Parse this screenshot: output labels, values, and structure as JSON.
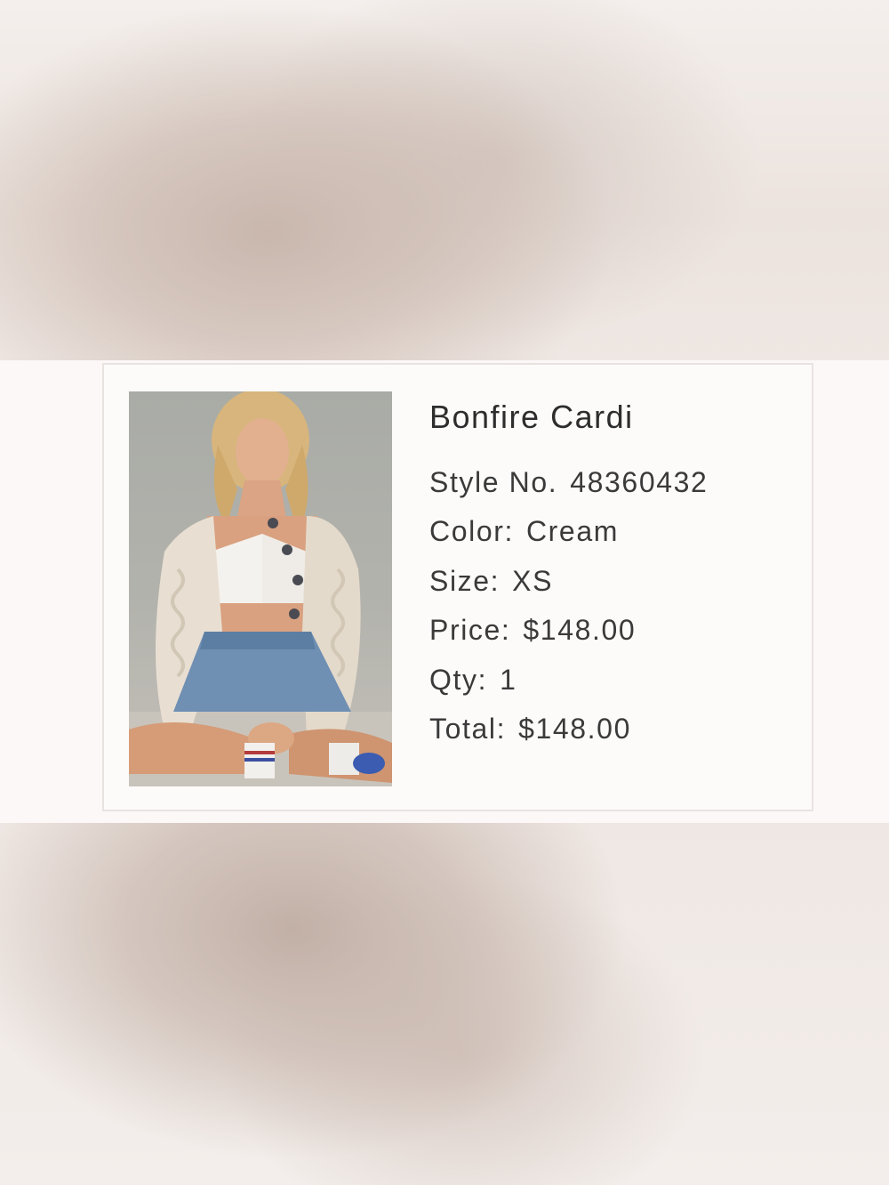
{
  "product": {
    "name": "Bonfire Cardi",
    "image_alt": "Model wearing cream cable-knit cardigan with denim skirt",
    "details": [
      {
        "label": "Style No.",
        "value": "48360432"
      },
      {
        "label": "Color:",
        "value": "Cream"
      },
      {
        "label": "Size:",
        "value": "XS"
      },
      {
        "label": "Price:",
        "value": "$148.00"
      },
      {
        "label": "Qty:",
        "value": "1"
      },
      {
        "label": "Total:",
        "value": "$148.00"
      }
    ]
  },
  "colors": {
    "card_border": "#e9e3e0",
    "text": "#2d2d2d",
    "background": "#f6f1ef"
  }
}
